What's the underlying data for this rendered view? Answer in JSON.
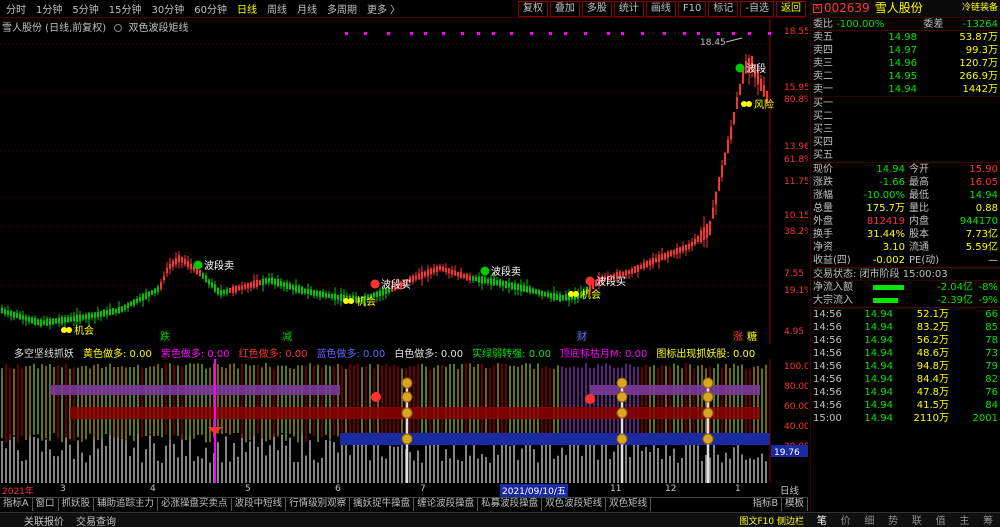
{
  "toolbar": {
    "periods": [
      "分时",
      "1分钟",
      "5分钟",
      "15分钟",
      "30分钟",
      "60分钟",
      "日线",
      "周线",
      "月线",
      "多周期",
      "更多 〉"
    ],
    "active_period": "日线",
    "buttons": [
      "复权",
      "叠加",
      "多股",
      "统计",
      "画线",
      "F10",
      "标记",
      "-自选",
      "返回"
    ]
  },
  "chart": {
    "title": "雪人股份 (日线,前复权)",
    "indicator_name": "双色波段矩线",
    "price_labels": [
      "18.55",
      "15.95",
      "13.96",
      "11.75",
      "10.15",
      "7.55",
      "4.95"
    ],
    "pct_labels": [
      "80.8%",
      "61.8%",
      "38.2%",
      "19.1%"
    ],
    "high_label": "18.45",
    "signals": [
      {
        "text": "波段卖",
        "kind": "sell"
      },
      {
        "text": "波段卖",
        "kind": "sell"
      },
      {
        "text": "波段买",
        "kind": "buy"
      },
      {
        "text": "波段买",
        "kind": "buy"
      },
      {
        "text": "波段",
        "kind": "sell"
      },
      {
        "text": "风险",
        "kind": "risk"
      },
      {
        "text": "机会",
        "kind": "chance"
      },
      {
        "text": "机会",
        "kind": "chance"
      },
      {
        "text": "机会",
        "kind": "chance"
      }
    ],
    "markers": [
      "跌",
      "减",
      "财",
      "涨",
      "糖"
    ]
  },
  "indicator": {
    "title": "多空坚线抓妖",
    "items": [
      {
        "label": "黄色做多: 0.00",
        "color": "#ffff00"
      },
      {
        "label": "紫色做多: 0.00",
        "color": "#ff00ff"
      },
      {
        "label": "红色做多: 0.00",
        "color": "#ff3232"
      },
      {
        "label": "蓝色做多: 0.00",
        "color": "#6464ff"
      },
      {
        "label": "白色做多: 0.00",
        "color": "#e0e0e0"
      },
      {
        "label": "实绿弱转强: 0.00",
        "color": "#00e600"
      },
      {
        "label": "顶底标枯月M: 0.00",
        "color": "#ff00ff"
      },
      {
        "label": "图标出现抓妖股: 0.00",
        "color": "#ffff00"
      }
    ],
    "scale": [
      "100.00",
      "80.00",
      "60.00",
      "40.00",
      "20.00"
    ],
    "current_value": "19.76",
    "dates": [
      "2021年",
      "3",
      "4",
      "5",
      "6",
      "7",
      "8",
      "2021/09/10/五",
      "11",
      "12",
      "1"
    ],
    "period_label": "日线"
  },
  "tabs": [
    "指标A",
    "窗口",
    "抓妖股",
    "辅助追踪主力",
    "必涨操盘买卖点",
    "波段中短线",
    "行情级别观察",
    "擒妖捉牛操盘",
    "缠论波段操盘",
    "私募波段操盘",
    "双色波段矩线",
    "双色矩线"
  ],
  "tabs_extra": [
    "指标B",
    "模板"
  ],
  "status": {
    "left": [
      "关联报价",
      "交易查询"
    ],
    "right": "图文F10 侧边栏"
  },
  "quote": {
    "code": "002639",
    "name": "雪人股份",
    "tag": "冷链装备",
    "wb_label": "委比",
    "wb_value": "-100.00%",
    "wc_label": "委差",
    "wc_value": "-13264",
    "asks": [
      {
        "label": "卖五",
        "price": "14.98",
        "vol": "53.87万"
      },
      {
        "label": "卖四",
        "price": "14.97",
        "vol": "99.3万"
      },
      {
        "label": "卖三",
        "price": "14.96",
        "vol": "120.7万"
      },
      {
        "label": "卖二",
        "price": "14.95",
        "vol": "266.9万"
      },
      {
        "label": "卖一",
        "price": "14.94",
        "vol": "1442万"
      }
    ],
    "bids": [
      "买一",
      "买二",
      "买三",
      "买四",
      "买五"
    ],
    "stats": [
      {
        "l1": "现价",
        "v1": "14.94",
        "c1": "green",
        "l2": "今开",
        "v2": "15.90",
        "c2": "red"
      },
      {
        "l1": "涨跌",
        "v1": "-1.66",
        "c1": "green",
        "l2": "最高",
        "v2": "16.05",
        "c2": "red"
      },
      {
        "l1": "涨幅",
        "v1": "-10.00%",
        "c1": "green",
        "l2": "最低",
        "v2": "14.94",
        "c2": "green"
      },
      {
        "l1": "总量",
        "v1": "175.7万",
        "c1": "yellow",
        "l2": "量比",
        "v2": "0.88",
        "c2": "yellow"
      },
      {
        "l1": "外盘",
        "v1": "812419",
        "c1": "red",
        "l2": "内盘",
        "v2": "944170",
        "c2": "green"
      },
      {
        "l1": "换手",
        "v1": "31.44%",
        "c1": "yellow",
        "l2": "股本",
        "v2": "7.73亿",
        "c2": "yellow"
      },
      {
        "l1": "净资",
        "v1": "3.10",
        "c1": "yellow",
        "l2": "流通",
        "v2": "5.59亿",
        "c2": "yellow"
      },
      {
        "l1": "收益(四)",
        "v1": "-0.002",
        "c1": "yellow",
        "l2": "PE(动)",
        "v2": "—",
        "c2": "white"
      }
    ],
    "trade_status": "交易状态: 闭市阶段 15:00:03",
    "flows": [
      {
        "label": "净流入额",
        "value": "-2.04亿",
        "pct": "-8%",
        "level": 0.55
      },
      {
        "label": "大宗流入",
        "value": "-2.39亿",
        "pct": "-9%",
        "level": 0.45
      }
    ],
    "ticks": [
      {
        "t": "14:56",
        "p": "14.94",
        "v": "52.1万",
        "c": "66"
      },
      {
        "t": "14:56",
        "p": "14.94",
        "v": "83.2万",
        "c": "85"
      },
      {
        "t": "14:56",
        "p": "14.94",
        "v": "56.2万",
        "c": "78"
      },
      {
        "t": "14:56",
        "p": "14.94",
        "v": "48.6万",
        "c": "73"
      },
      {
        "t": "14:56",
        "p": "14.94",
        "v": "94.8万",
        "c": "79"
      },
      {
        "t": "14:56",
        "p": "14.94",
        "v": "84.4万",
        "c": "82"
      },
      {
        "t": "14:56",
        "p": "14.94",
        "v": "47.8万",
        "c": "76"
      },
      {
        "t": "14:56",
        "p": "14.94",
        "v": "41.5万",
        "c": "84"
      },
      {
        "t": "15:00",
        "p": "14.94",
        "v": "2110万",
        "c": "2001"
      }
    ],
    "side_tabs": [
      "笔",
      "价",
      "细",
      "势",
      "联",
      "值",
      "主",
      "筹"
    ]
  }
}
